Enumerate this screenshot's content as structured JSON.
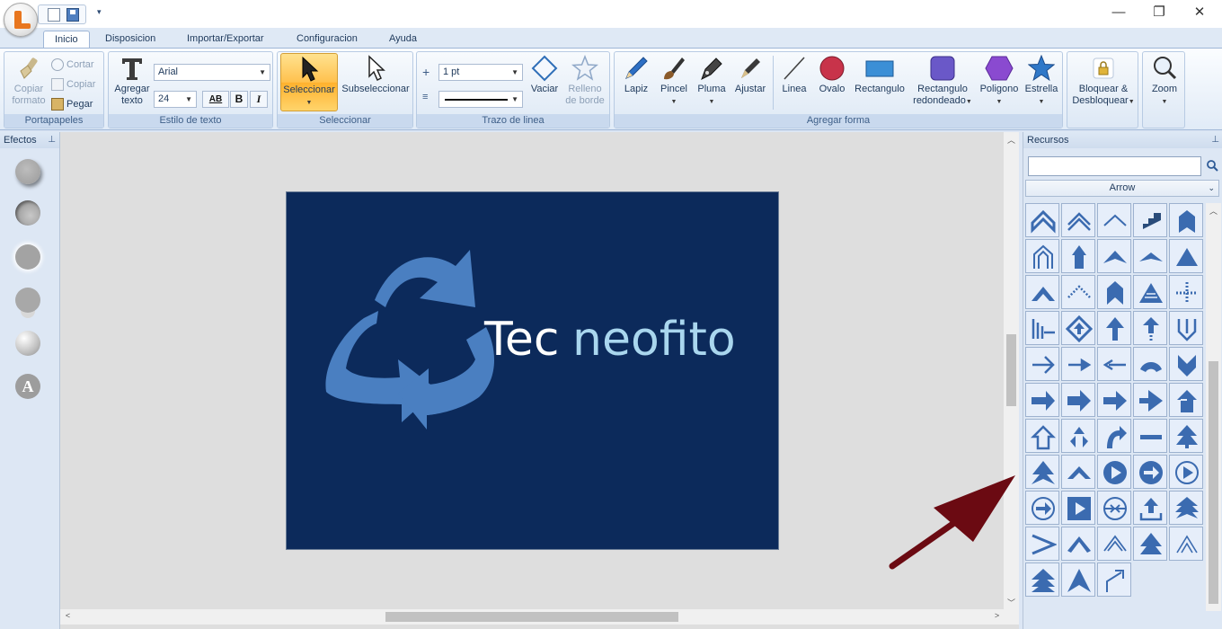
{
  "titlebar": {
    "minimize": "—",
    "maximize": "❐",
    "close": "✕",
    "qat_more": "▾"
  },
  "tabs": [
    {
      "label": "Inicio",
      "active": true
    },
    {
      "label": "Disposicion"
    },
    {
      "label": "Importar/Exportar"
    },
    {
      "label": "Configuracion"
    },
    {
      "label": "Ayuda"
    }
  ],
  "clipboard": {
    "label": "Portapapeles",
    "paste_format": "Copiar\nformato",
    "cut": "Cortar",
    "copy": "Copiar",
    "paste": "Pegar"
  },
  "text_style": {
    "label": "Estilo de texto",
    "add_text": "Agregar\ntexto",
    "font": "Arial",
    "size": "24",
    "bold": "B",
    "italic": "I",
    "spacing": "AB"
  },
  "select": {
    "label": "Seleccionar",
    "select": "Seleccionar",
    "subselect": "Subseleccionar"
  },
  "stroke": {
    "label": "Trazo de linea",
    "width": "1 pt",
    "empty": "Vaciar",
    "border_fill": "Relleno\nde borde"
  },
  "shapes": {
    "label": "Agregar forma",
    "pencil": "Lapiz",
    "brush": "Pincel",
    "pen": "Pluma",
    "adjust": "Ajustar",
    "line": "Linea",
    "oval": "Ovalo",
    "rect": "Rectangulo",
    "round_rect": "Rectangulo\nredondeado",
    "polygon": "Poligono",
    "star": "Estrella"
  },
  "lock": {
    "label": "Bloquear &\nDesbloquear"
  },
  "zoom": {
    "label": "Zoom"
  },
  "effects_panel": {
    "title": "Efectos",
    "pin": "⊥",
    "text_effect": "A"
  },
  "resources_panel": {
    "title": "Recursos",
    "pin": "⊥",
    "search_value": "",
    "category": "Arrow"
  },
  "canvas": {
    "brand_left": "Tec",
    "brand_right": "neofito"
  },
  "colors": {
    "accent": "#3b6bb0",
    "image_bg": "#0c2a5b",
    "recycle": "#4a7fc1",
    "annotation": "#6b0a12"
  },
  "arrow_icons": [
    "double-chevron-up",
    "double-chevron-up-outline",
    "chevron-up-thin",
    "stair-arrow",
    "bookmark-arrow",
    "house-arrow",
    "tall-arrow",
    "wide-chevron",
    "flat-chevron",
    "triangle-up",
    "chevron-up-bold",
    "dotted-chevron",
    "bookmark-up",
    "striped-triangle",
    "dotted-arrow",
    "barb-arrow-left",
    "diamond-arrow",
    "arrow-up",
    "stripe-arrow-up",
    "u-arrow-up",
    "arrow-right-outline",
    "arrow-right-thin",
    "arrow-left-thin",
    "round-chevron",
    "shield-arrow",
    "block-arrow-right",
    "arrow-right-bold",
    "block-arrow-right-2",
    "triangle-arrow-right",
    "notched-arrow-up",
    "outline-arrow-up",
    "recycle",
    "curved-arrow",
    "bar-arrow",
    "pine-arrow",
    "double-tree-arrow",
    "chevron-arch",
    "circle-play",
    "circle-arrow-right",
    "circle-play-outline",
    "circle-arrow-outline",
    "square-play",
    "circle-split",
    "upload-arrow",
    "triple-chevron",
    "greater-than",
    "m-chevron",
    "v-lines",
    "tree-arrow",
    "thin-chevron-up",
    "stacked-triangle",
    "big-chevron-up",
    "bent-arrow"
  ]
}
